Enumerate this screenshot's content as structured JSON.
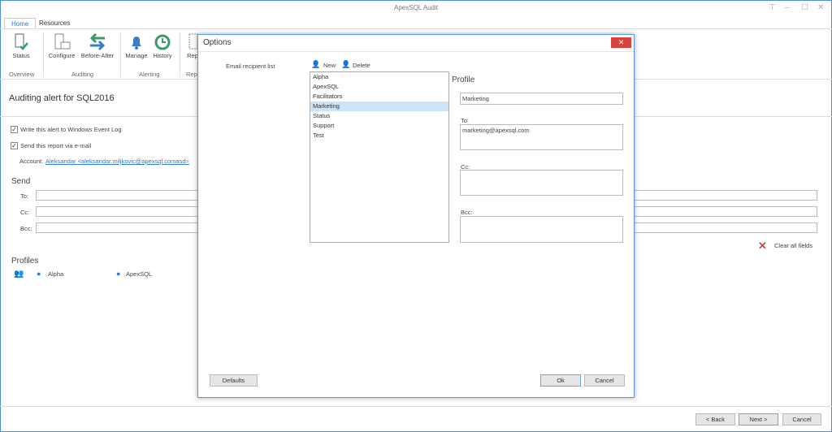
{
  "app": {
    "title": "ApexSQL Audit"
  },
  "tabs": [
    {
      "label": "Home",
      "active": true
    },
    {
      "label": "Resources"
    }
  ],
  "ribbon": {
    "buttons": [
      {
        "label": "Status",
        "icon": "server-check-icon"
      },
      {
        "label": "Configure",
        "icon": "server-config-icon"
      },
      {
        "label": "Before-After",
        "icon": "swap-arrows-icon"
      },
      {
        "label": "Manage",
        "icon": "bell-icon"
      },
      {
        "label": "History",
        "icon": "history-icon"
      },
      {
        "label": "Rep",
        "icon": "report-icon"
      }
    ],
    "groups": [
      "Overview",
      "Auditing",
      "Alerting",
      "Rep"
    ]
  },
  "main": {
    "heading": "Auditing alert for SQL2016",
    "write_event_log": {
      "label": "Write this alert to Windows Event Log",
      "checked": true
    },
    "send_email": {
      "label": "Send this report via e-mail",
      "checked": true
    },
    "account_label": "Account:",
    "account_value": "Aleksandar <aleksandar.miljkovic@apexsql.comasd>",
    "send_title": "Send",
    "to_label": "To:",
    "cc_label": "Cc:",
    "bcc_label": "Bcc:",
    "clear_label": "Clear all fields",
    "profiles_title": "Profiles",
    "profiles": [
      "Alpha",
      "ApexSQL"
    ]
  },
  "footer": {
    "back": "< Back",
    "next": "Next >",
    "cancel": "Cancel"
  },
  "dialog": {
    "title": "Options",
    "section_label": "Email recipient list",
    "new_label": "New",
    "delete_label": "Delete",
    "list": [
      "Alpha",
      "ApexSQL",
      "Facilitators",
      "Marketing",
      "Status",
      "Support",
      "Test"
    ],
    "selected": "Marketing",
    "profile_title": "Profile",
    "profile_name": "Marketing",
    "to_label": "To:",
    "to_value": "marketing@apexsql.com",
    "cc_label": "Cc:",
    "cc_value": "",
    "bcc_label": "Bcc:",
    "bcc_value": "",
    "defaults": "Defaults",
    "ok": "Ok",
    "cancel": "Cancel"
  },
  "colors": {
    "accent": "#2b7bd0",
    "close_red": "#d9443d",
    "selection": "#cde4f7",
    "icon_blue": "#3b7dc4",
    "icon_green": "#3a9a6a"
  }
}
